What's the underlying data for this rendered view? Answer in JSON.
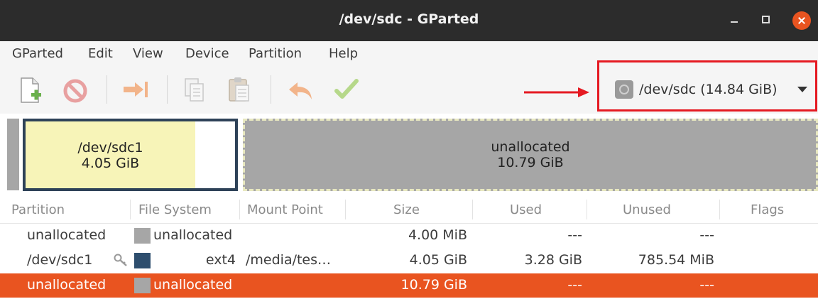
{
  "window": {
    "title": "/dev/sdc - GParted"
  },
  "menu": [
    "GParted",
    "Edit",
    "View",
    "Device",
    "Partition",
    "Help"
  ],
  "toolbar": {
    "icons": [
      "new-partition-icon",
      "delete-icon",
      "resize-move-icon",
      "copy-icon",
      "paste-icon",
      "undo-icon",
      "apply-icon"
    ]
  },
  "device_selector": {
    "label": "/dev/sdc  (14.84 GiB)",
    "icon": "disk-icon"
  },
  "disk_visual": {
    "partition1": {
      "name": "/dev/sdc1",
      "size": "4.05 GiB"
    },
    "unallocated": {
      "name": "unallocated",
      "size": "10.79 GiB"
    }
  },
  "table": {
    "headers": [
      "Partition",
      "File System",
      "Mount Point",
      "Size",
      "Used",
      "Unused",
      "Flags"
    ],
    "rows": [
      {
        "partition": "unallocated",
        "filesystem": "unallocated",
        "fs_color": "#a6a6a6",
        "mount": "",
        "size": "4.00 MiB",
        "used": "---",
        "unused": "---",
        "flags": "",
        "selected": false,
        "key": false
      },
      {
        "partition": "/dev/sdc1",
        "filesystem": "ext4",
        "fs_color": "#2e4e6e",
        "mount": "/media/tes…",
        "size": "4.05 GiB",
        "used": "3.28 GiB",
        "unused": "785.54 MiB",
        "flags": "",
        "selected": false,
        "key": true
      },
      {
        "partition": "unallocated",
        "filesystem": "unallocated",
        "fs_color": "#a6a6a6",
        "mount": "",
        "size": "10.79 GiB",
        "used": "---",
        "unused": "---",
        "flags": "",
        "selected": true,
        "key": false
      }
    ]
  },
  "colors": {
    "titlebar": "#2c2c2c",
    "accent": "#e95420",
    "highlight_box": "#e51a22",
    "partition_fill": "#f7f4b8",
    "partition_border": "#2e4258",
    "unallocated": "#a6a6a6"
  }
}
